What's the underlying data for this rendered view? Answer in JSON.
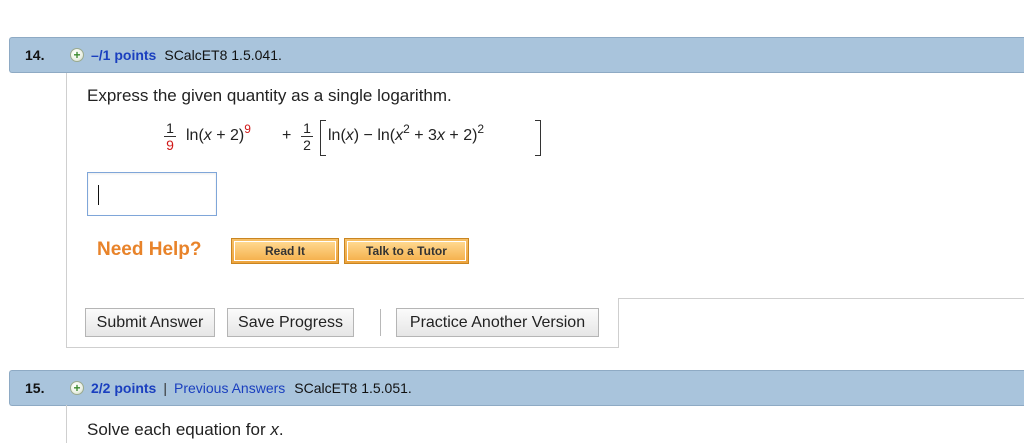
{
  "q14": {
    "number": "14.",
    "plus": "+",
    "points": "–/1 points",
    "code": "SCalcET8 1.5.041.",
    "prompt": "Express the given quantity as a single logarithm.",
    "expression": {
      "frac1_num": "1",
      "frac1_den": "9",
      "t1": "ln(",
      "t1_var": "x",
      "t1_rest": " + 2)",
      "t1_exp": "9",
      "plus_sign": "+",
      "frac2_num": "1",
      "frac2_den": "2",
      "t2": "ln(",
      "t2_var": "x",
      "t2_mid": ") − ln(",
      "t2_var2": "x",
      "t2_exp2": "2",
      "t2_mid2": " + 3",
      "t2_var3": "x",
      "t2_end": " + 2)",
      "t2_exp": "2"
    },
    "answer_value": "",
    "need_help": "Need Help?",
    "read_it": "Read It",
    "talk_tutor": "Talk to a Tutor",
    "submit": "Submit Answer",
    "save": "Save Progress",
    "practice": "Practice Another Version"
  },
  "q15": {
    "number": "15.",
    "plus": "+",
    "points": "2/2 points",
    "separator": "|",
    "previous": "Previous Answers",
    "code": "SCalcET8 1.5.051.",
    "prompt_text": "Solve each equation for ",
    "prompt_var": "x",
    "prompt_end": "."
  },
  "colors": {
    "header_bg": "#a9c4dc",
    "link_blue": "#1a3fbf",
    "need_help_orange": "#e8832a",
    "exponent_red": "#d01818"
  }
}
